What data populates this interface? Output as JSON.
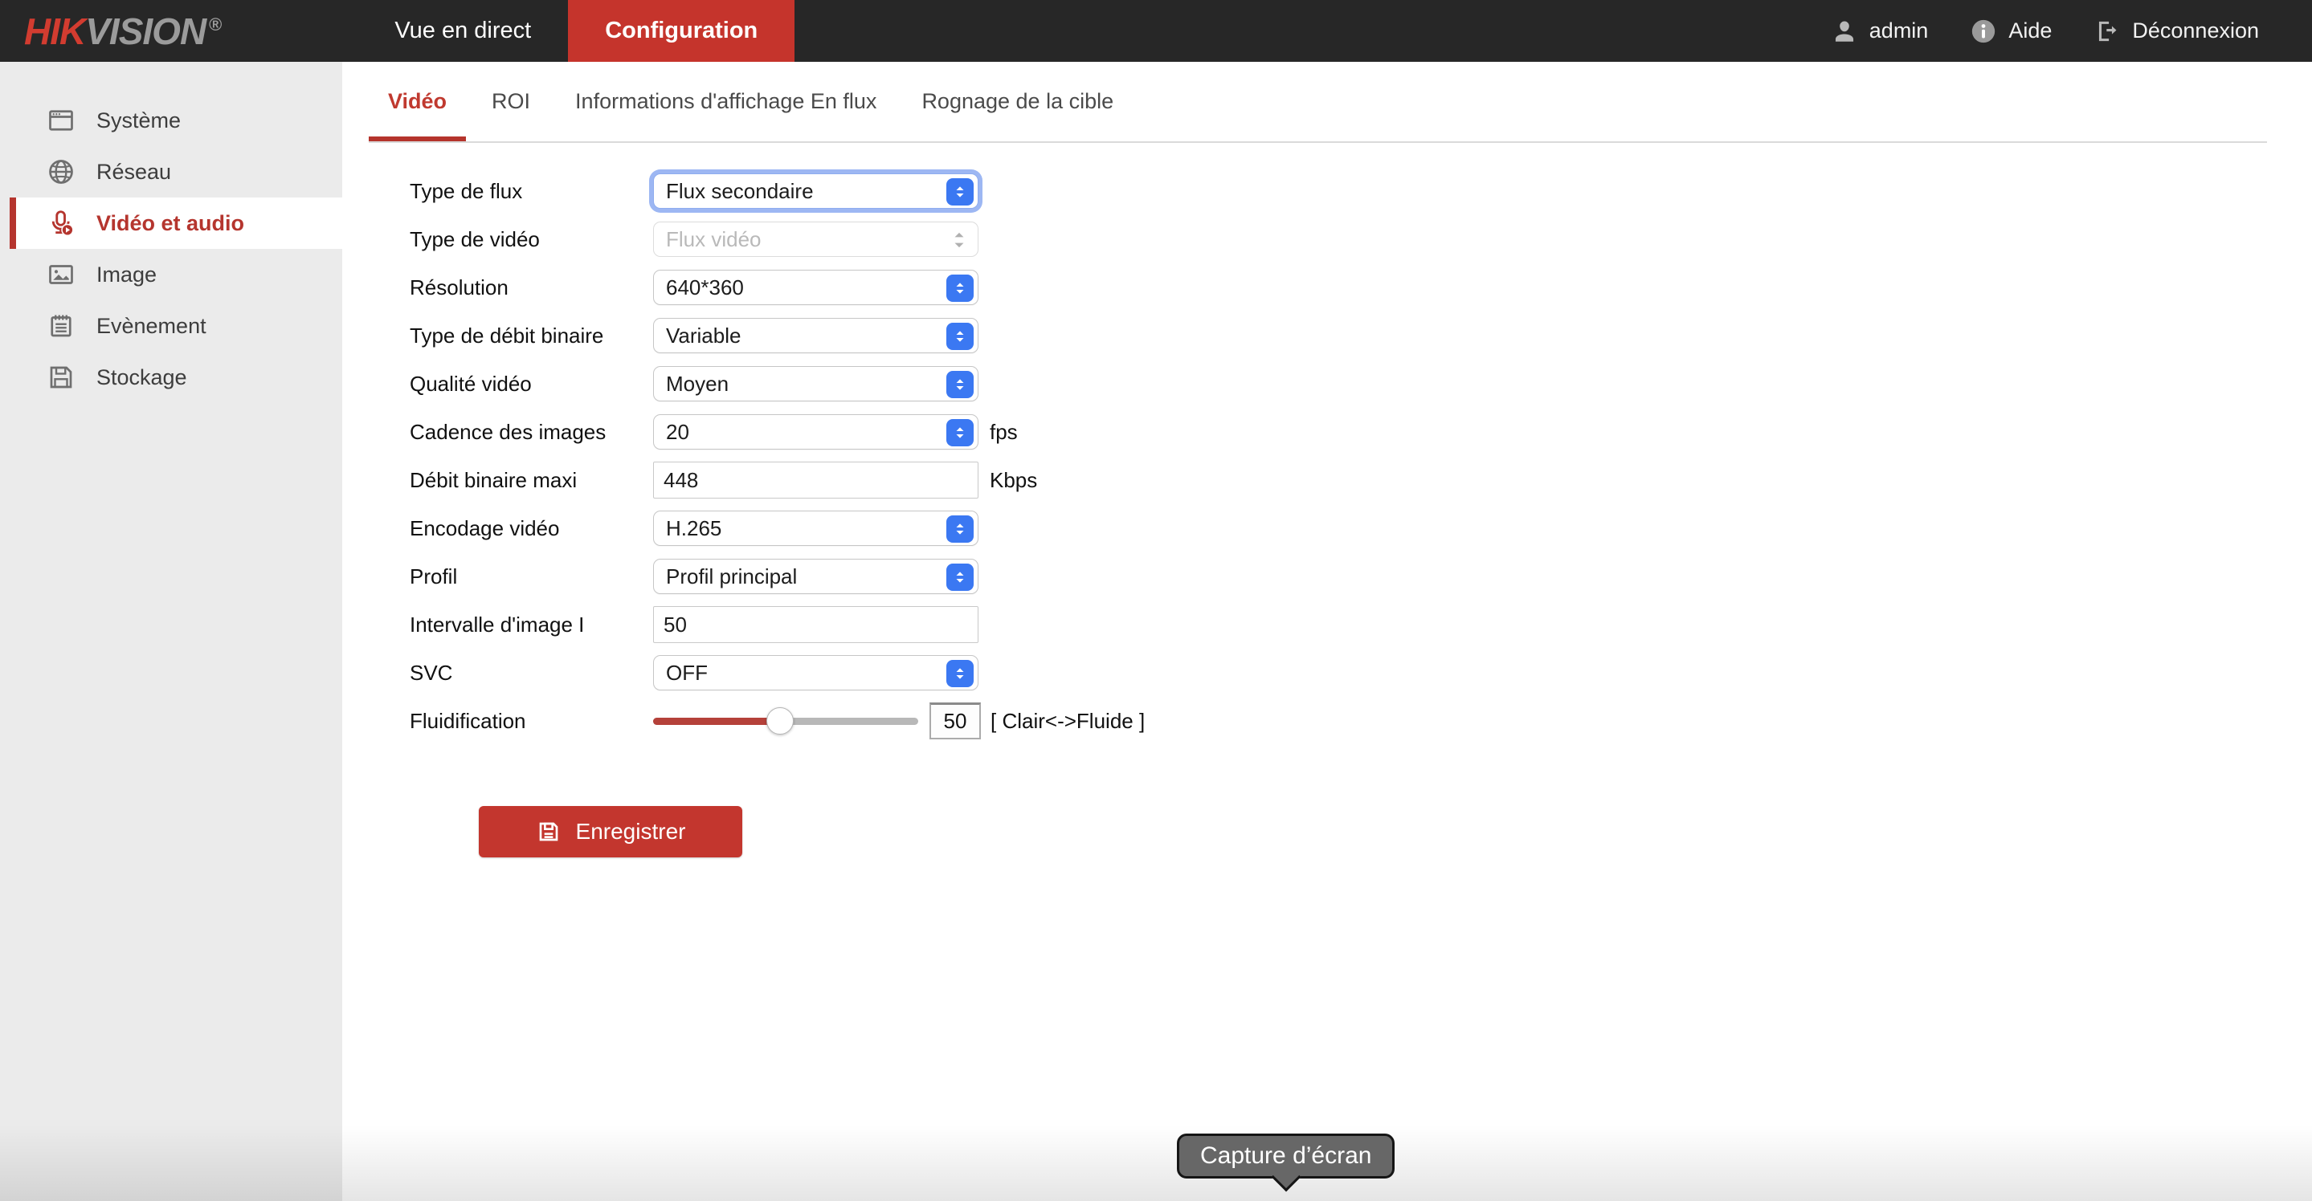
{
  "topbar": {
    "logo": {
      "part1": "HIK",
      "part2": "VISION",
      "registered": "®"
    },
    "nav": [
      {
        "label": "Vue en direct",
        "active": false
      },
      {
        "label": "Configuration",
        "active": true
      }
    ],
    "user_name": "admin",
    "help_label": "Aide",
    "logout_label": "Déconnexion"
  },
  "sidebar": {
    "items": [
      {
        "label": "Système",
        "icon": "window-icon",
        "active": false
      },
      {
        "label": "Réseau",
        "icon": "globe-icon",
        "active": false
      },
      {
        "label": "Vidéo et audio",
        "icon": "microphone-play-icon",
        "active": true
      },
      {
        "label": "Image",
        "icon": "picture-icon",
        "active": false
      },
      {
        "label": "Evènement",
        "icon": "event-note-icon",
        "active": false
      },
      {
        "label": "Stockage",
        "icon": "floppy-disk-icon",
        "active": false
      }
    ]
  },
  "content": {
    "tabs": [
      {
        "label": "Vidéo",
        "active": true
      },
      {
        "label": "ROI",
        "active": false
      },
      {
        "label": "Informations d'affichage En flux",
        "active": false
      },
      {
        "label": "Rognage de la cible",
        "active": false
      }
    ],
    "form": {
      "rows": [
        {
          "label": "Type de flux",
          "control": "select",
          "value": "Flux secondaire",
          "state": "focused"
        },
        {
          "label": "Type de vidéo",
          "control": "select",
          "value": "Flux vidéo",
          "state": "disabled"
        },
        {
          "label": "Résolution",
          "control": "select",
          "value": "640*360"
        },
        {
          "label": "Type de débit binaire",
          "control": "select",
          "value": "Variable"
        },
        {
          "label": "Qualité vidéo",
          "control": "select",
          "value": "Moyen"
        },
        {
          "label": "Cadence des images",
          "control": "select",
          "value": "20",
          "unit": "fps"
        },
        {
          "label": "Débit binaire maxi",
          "control": "input",
          "value": "448",
          "unit": "Kbps"
        },
        {
          "label": "Encodage vidéo",
          "control": "select",
          "value": "H.265"
        },
        {
          "label": "Profil",
          "control": "select",
          "value": "Profil principal"
        },
        {
          "label": "Intervalle d'image I",
          "control": "input",
          "value": "50"
        },
        {
          "label": "SVC",
          "control": "select",
          "value": "OFF"
        },
        {
          "label": "Fluidification",
          "control": "slider",
          "value": "50",
          "percent": 48,
          "hint": "[ Clair<->Fluide ]"
        }
      ]
    },
    "save_button": {
      "label": "Enregistrer"
    }
  },
  "tooltip": {
    "label": "Capture d’écran"
  },
  "colors": {
    "topbar_bg": "#272727",
    "brand_red": "#c5342c",
    "sidebar_active_red": "#b5352e",
    "select_blue": "#3b78f2",
    "slider_red": "#b5413a"
  }
}
